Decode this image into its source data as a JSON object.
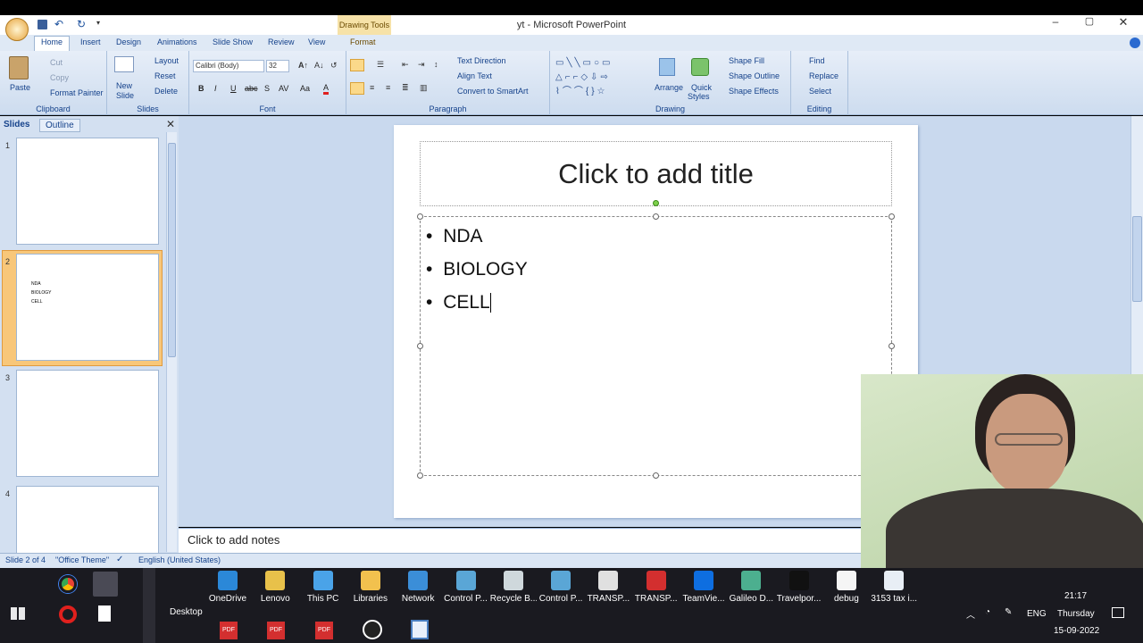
{
  "window": {
    "title": "yt - Microsoft PowerPoint",
    "context_tab_group": "Drawing Tools"
  },
  "tabs": [
    "Home",
    "Insert",
    "Design",
    "Animations",
    "Slide Show",
    "Review",
    "View",
    "Format"
  ],
  "ribbon": {
    "clipboard": {
      "label": "Clipboard",
      "paste": "Paste",
      "cut": "Cut",
      "copy": "Copy",
      "format_painter": "Format Painter"
    },
    "slides": {
      "label": "Slides",
      "new_slide_1": "New",
      "new_slide_2": "Slide",
      "layout": "Layout",
      "reset": "Reset",
      "delete": "Delete"
    },
    "font": {
      "label": "Font",
      "font_name": "Calibri (Body)",
      "font_size": "32"
    },
    "paragraph": {
      "label": "Paragraph",
      "text_direction": "Text Direction",
      "align_text": "Align Text",
      "convert_smartart": "Convert to SmartArt"
    },
    "drawing": {
      "label": "Drawing",
      "arrange": "Arrange",
      "quick_styles_1": "Quick",
      "quick_styles_2": "Styles",
      "shape_fill": "Shape Fill",
      "shape_outline": "Shape Outline",
      "shape_effects": "Shape Effects"
    },
    "editing": {
      "label": "Editing",
      "find": "Find",
      "replace": "Replace",
      "select": "Select"
    }
  },
  "panel": {
    "tabs": [
      "Slides",
      "Outline"
    ],
    "slide_numbers": [
      "1",
      "2",
      "3",
      "4"
    ],
    "thumb2_bullets": [
      "NDA",
      "BIOLOGY",
      "CELL"
    ]
  },
  "slide": {
    "title_placeholder": "Click to add title",
    "bullets": [
      "NDA",
      "BIOLOGY",
      "CELL"
    ]
  },
  "notes_placeholder": "Click to add notes",
  "status": {
    "slide": "Slide 2 of 4",
    "theme": "\"Office Theme\"",
    "language": "English (United States)"
  },
  "taskbar": {
    "desktop_label": "Desktop",
    "icons": [
      {
        "label": "OneDrive",
        "color": "#2b88d8"
      },
      {
        "label": "Lenovo",
        "color": "#e8c14a"
      },
      {
        "label": "This PC",
        "color": "#4aa3e8"
      },
      {
        "label": "Libraries",
        "color": "#f2c14e"
      },
      {
        "label": "Network",
        "color": "#3b8ed8"
      },
      {
        "label": "Control P...",
        "color": "#5aa6d6"
      },
      {
        "label": "Recycle B...",
        "color": "#cfd8dc"
      },
      {
        "label": "Control P...",
        "color": "#5aa6d6"
      },
      {
        "label": "TRANSP...",
        "color": "#e0e0e0"
      },
      {
        "label": "TRANSP...",
        "color": "#d32f2f"
      },
      {
        "label": "TeamVie...",
        "color": "#0e6ee0"
      },
      {
        "label": "Galileo D...",
        "color": "#4caf8f"
      },
      {
        "label": "Travelpor...",
        "color": "#111111"
      },
      {
        "label": "debug",
        "color": "#f5f5f5"
      },
      {
        "label": "3153 tax i...",
        "color": "#e8eef5"
      }
    ],
    "tray_lang": "ENG",
    "clock_time": "21:17",
    "clock_day": "Thursday",
    "clock_date": "15-09-2022"
  }
}
